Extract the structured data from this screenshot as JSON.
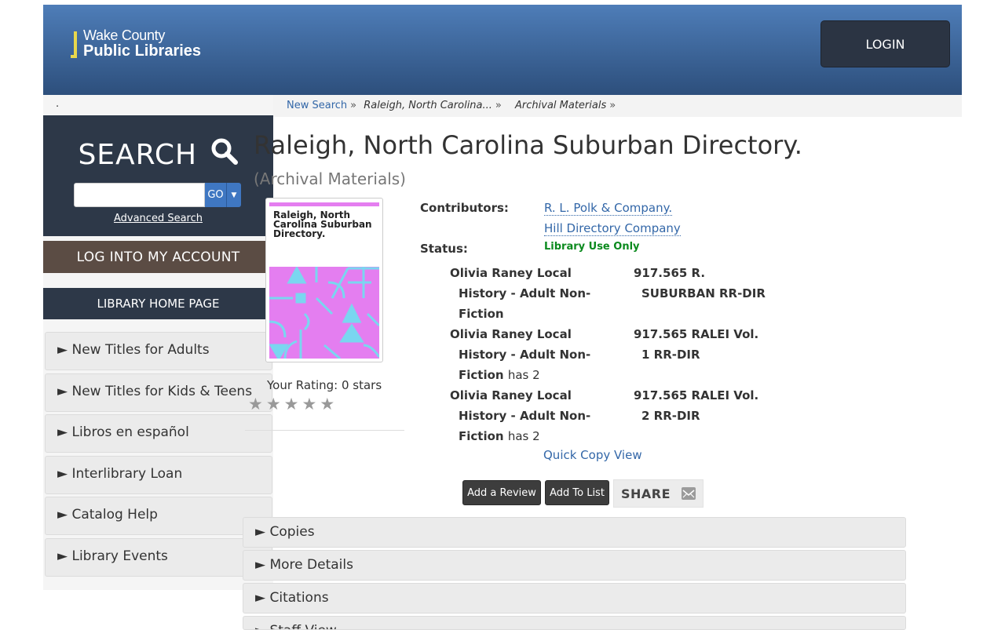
{
  "header": {
    "logo_line1": "Wake County",
    "logo_line2": "Public Libraries",
    "login_label": "LOGIN"
  },
  "sidebar": {
    "dot": ".",
    "search_title": "SEARCH",
    "go_label": "GO",
    "advanced_search": "Advanced Search",
    "log_into_account": "LOG INTO MY ACCOUNT",
    "library_home": "LIBRARY HOME PAGE",
    "menu": [
      "► New Titles for Adults",
      "► New Titles for Kids & Teens",
      "► Libros en español",
      "► Interlibrary Loan",
      "► Catalog Help",
      "► Library Events"
    ]
  },
  "breadcrumb": {
    "new_search": "New Search",
    "item": "Raleigh, North Carolina...",
    "format": "Archival Materials",
    "sep": "»"
  },
  "record": {
    "title": "Raleigh, North Carolina Suburban Directory.",
    "format": "(Archival Materials)",
    "cover_title": "Raleigh, North Carolina Suburban Directory.",
    "rating_text": "Your Rating: 0 stars",
    "rating_value": 0,
    "rating_max": 5,
    "contributors_label": "Contributors:",
    "contributors": [
      "R. L. Polk & Company.",
      "Hill Directory Company"
    ],
    "status_label": "Status:",
    "status_value": "Library Use Only",
    "holdings": [
      {
        "location_l1": "Olivia Raney Local",
        "location_l2": "History - Adult Non-",
        "location_l3": "Fiction",
        "has": "",
        "call_l1": "917.565 R.",
        "call_l2": "SUBURBAN RR-DIR"
      },
      {
        "location_l1": "Olivia Raney Local",
        "location_l2": "History - Adult Non-",
        "location_l3": "Fiction",
        "has": "has 2",
        "call_l1": "917.565 RALEI Vol.",
        "call_l2": "1 RR-DIR"
      },
      {
        "location_l1": "Olivia Raney Local",
        "location_l2": "History - Adult Non-",
        "location_l3": "Fiction",
        "has": "has 2",
        "call_l1": "917.565 RALEI Vol.",
        "call_l2": "2 RR-DIR"
      }
    ],
    "quick_copy": "Quick Copy View",
    "add_review": "Add a Review",
    "add_to_list": "Add To List",
    "share": "SHARE"
  },
  "accordions": [
    "► Copies",
    "► More Details",
    "► Citations",
    "► Staff View"
  ],
  "colors": {
    "header_top": "#4e7db8",
    "header_bottom": "#2d4f7c",
    "sidebar_dark": "#2d3848",
    "account_brown": "#5b4c44",
    "link_blue": "#3367a8",
    "status_green": "#0b8a1e",
    "cover_pink": "#e47ef0",
    "cover_cyan": "#7ad6f0"
  }
}
